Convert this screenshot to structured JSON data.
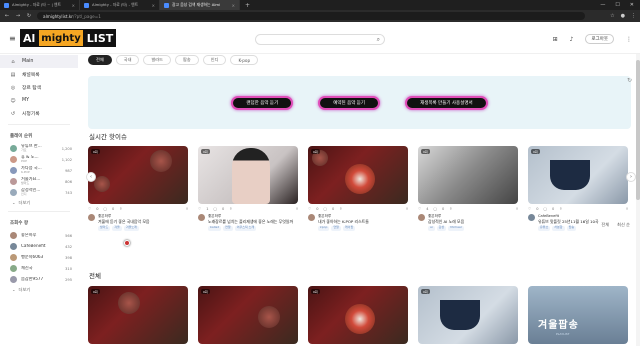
{
  "browser": {
    "tabs": [
      {
        "label": "Almighty - 자료 (타 ~ | 엔트",
        "active": false
      },
      {
        "label": "Almighty - 자료 (타) - 엔트",
        "active": false
      },
      {
        "label": "광고 음성 검색 재생하는 Almi",
        "active": true
      }
    ],
    "url_host": "almightylist.kr",
    "url_path": "/?ptl_page=1"
  },
  "header": {
    "logo_part1": "Al",
    "logo_part2": "mighty",
    "logo_part3": "LIST",
    "login_label": "로그아웃"
  },
  "sidebar": {
    "nav": [
      {
        "label": "Main",
        "icon": "home-icon",
        "active": true
      },
      {
        "label": "채널목록",
        "icon": "list-icon",
        "active": false
      },
      {
        "label": "장르 탐색",
        "icon": "compass-icon",
        "active": false
      },
      {
        "label": "MY",
        "icon": "user-icon",
        "active": false
      },
      {
        "label": "시청기록",
        "icon": "history-icon",
        "active": false
      }
    ],
    "ranking_title": "플레이 순위",
    "ranking": [
      {
        "name": "유튜브 한...",
        "sub": "가요",
        "count": "1,200"
      },
      {
        "name": "휴 & 노...",
        "sub": "POP",
        "count": "1,102"
      },
      {
        "name": "가다음 국...",
        "sub": "K-POP",
        "count": "987"
      },
      {
        "name": "거울가요...",
        "sub": "발라드",
        "count": "806"
      },
      {
        "name": "감성적인...",
        "sub": "인디",
        "count": "743"
      }
    ],
    "ranking_more": "더보기",
    "sub_title": "조회수 왕",
    "subs": [
      {
        "name": "좋은하루",
        "count": "566"
      },
      {
        "name": "CafeBenefit",
        "count": "432"
      },
      {
        "name": "행운의6063",
        "count": "398"
      },
      {
        "name": "체신국",
        "count": "310"
      },
      {
        "name": "음감한9577",
        "count": "295"
      }
    ],
    "subs_more": "더보기"
  },
  "chips": [
    "전체",
    "국내",
    "발라드",
    "팝송",
    "인디",
    "K-pop"
  ],
  "banner": {
    "buttons": [
      "랜덤한 음악 듣기",
      "예약된 음악 듣기",
      "재생목록 만들기 사용설명서"
    ]
  },
  "section1": {
    "title": "실시간 핫이슈",
    "cards": [
      {
        "badge": "0회",
        "likes": "0",
        "comments": "0",
        "author": "좋은하루",
        "title": "겨울에 듣기 좋은 국내음악 모음",
        "tags": [
          "발라드",
          "겨울",
          "겨울노래"
        ]
      },
      {
        "badge": "0회",
        "likes": "1",
        "comments": "0",
        "author": "좋은하루",
        "title": "노래장르를 넘치는 플리재생에 좋은 노래는 무엇일까",
        "tags": [
          "ballad",
          "연말",
          "어쿠스틱 노래"
        ]
      },
      {
        "badge": "0회",
        "likes": "0",
        "comments": "0",
        "author": "좋은하루",
        "title": "내가 좋아하는 K-POP 리스트들",
        "tags": [
          "kpop",
          "연말",
          "케이팝"
        ]
      },
      {
        "badge": "0회",
        "likes": "4",
        "comments": "0",
        "author": "좋은하루",
        "title": "감성적인 AI 노래 모음",
        "tags": [
          "ai",
          "감성",
          "Michael"
        ]
      },
      {
        "badge": "0회",
        "likes": "0",
        "comments": "0",
        "author": "CafeBenefit",
        "title": "유튜브 맛플릿 25년11월 16일 10곡",
        "tags": [
          "유튜브",
          "차분함",
          "팝송"
        ]
      }
    ]
  },
  "section2": {
    "title": "전체",
    "sort_label1": "전체",
    "sort_label2": "최신 순",
    "thumb_text": "겨울팝송",
    "thumb_sub": "PLAYLIST"
  }
}
